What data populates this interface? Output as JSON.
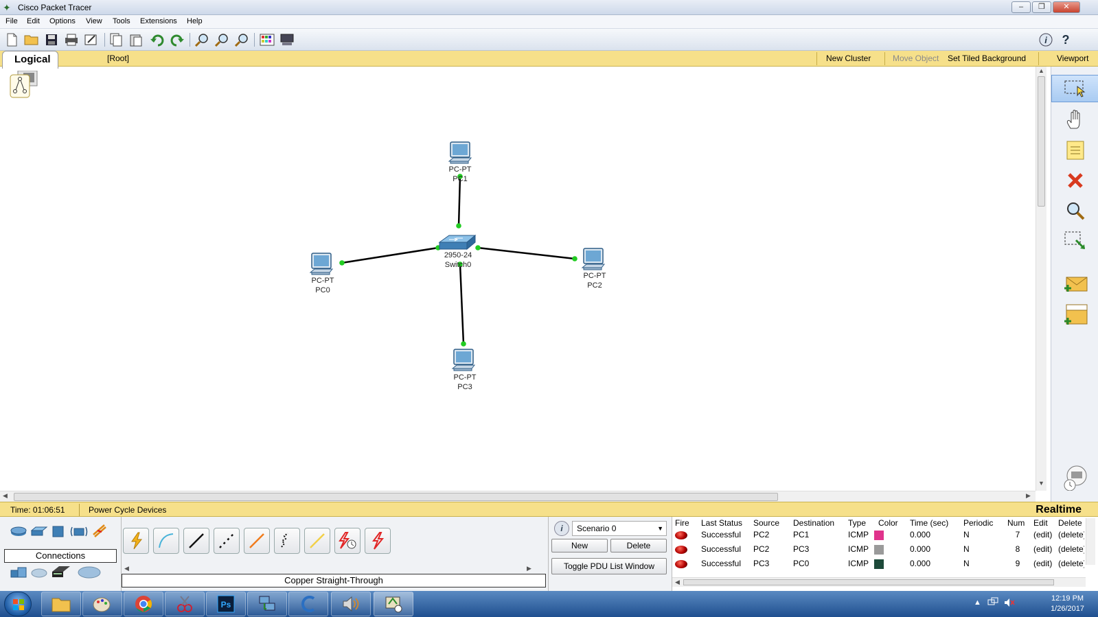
{
  "window": {
    "title": "Cisco Packet Tracer"
  },
  "menu": [
    "File",
    "Edit",
    "Options",
    "View",
    "Tools",
    "Extensions",
    "Help"
  ],
  "workspace": {
    "tab": "Logical",
    "root": "[Root]",
    "new_cluster": "New Cluster",
    "move_object": "Move Object",
    "set_background": "Set Tiled Background",
    "viewport": "Viewport"
  },
  "topology": {
    "devices": [
      {
        "id": "pc1",
        "type": "PC-PT",
        "name": "PC1"
      },
      {
        "id": "pc0",
        "type": "PC-PT",
        "name": "PC0"
      },
      {
        "id": "switch0",
        "type": "2950-24",
        "name": "Switch0"
      },
      {
        "id": "pc2",
        "type": "PC-PT",
        "name": "PC2"
      },
      {
        "id": "pc3",
        "type": "PC-PT",
        "name": "PC3"
      }
    ],
    "link_color": "#000000",
    "port_up_color": "#22cc22"
  },
  "status": {
    "time": "Time: 01:06:51",
    "power_cycle": "Power Cycle Devices",
    "mode": "Realtime"
  },
  "bottom": {
    "category_label": "Connections",
    "connection_label": "Copper Straight-Through",
    "scenario": "Scenario 0",
    "new_btn": "New",
    "delete_btn": "Delete",
    "toggle_btn": "Toggle PDU List Window"
  },
  "pdu_table": {
    "headers": [
      "Fire",
      "Last Status",
      "Source",
      "Destination",
      "Type",
      "Color",
      "Time (sec)",
      "Periodic",
      "Num",
      "Edit",
      "Delete"
    ],
    "rows": [
      {
        "status": "Successful",
        "source": "PC2",
        "destination": "PC1",
        "type": "ICMP",
        "color": "#e0338c",
        "time": "0.000",
        "periodic": "N",
        "num": "7",
        "edit": "(edit)",
        "delete": "(delete)"
      },
      {
        "status": "Successful",
        "source": "PC2",
        "destination": "PC3",
        "type": "ICMP",
        "color": "#9a9a9a",
        "time": "0.000",
        "periodic": "N",
        "num": "8",
        "edit": "(edit)",
        "delete": "(delete)"
      },
      {
        "status": "Successful",
        "source": "PC3",
        "destination": "PC0",
        "type": "ICMP",
        "color": "#1d4a3a",
        "time": "0.000",
        "periodic": "N",
        "num": "9",
        "edit": "(edit)",
        "delete": "(delete)"
      }
    ]
  },
  "taskbar": {
    "time": "12:19 PM",
    "date": "1/26/2017",
    "ps_label": "Ps"
  }
}
